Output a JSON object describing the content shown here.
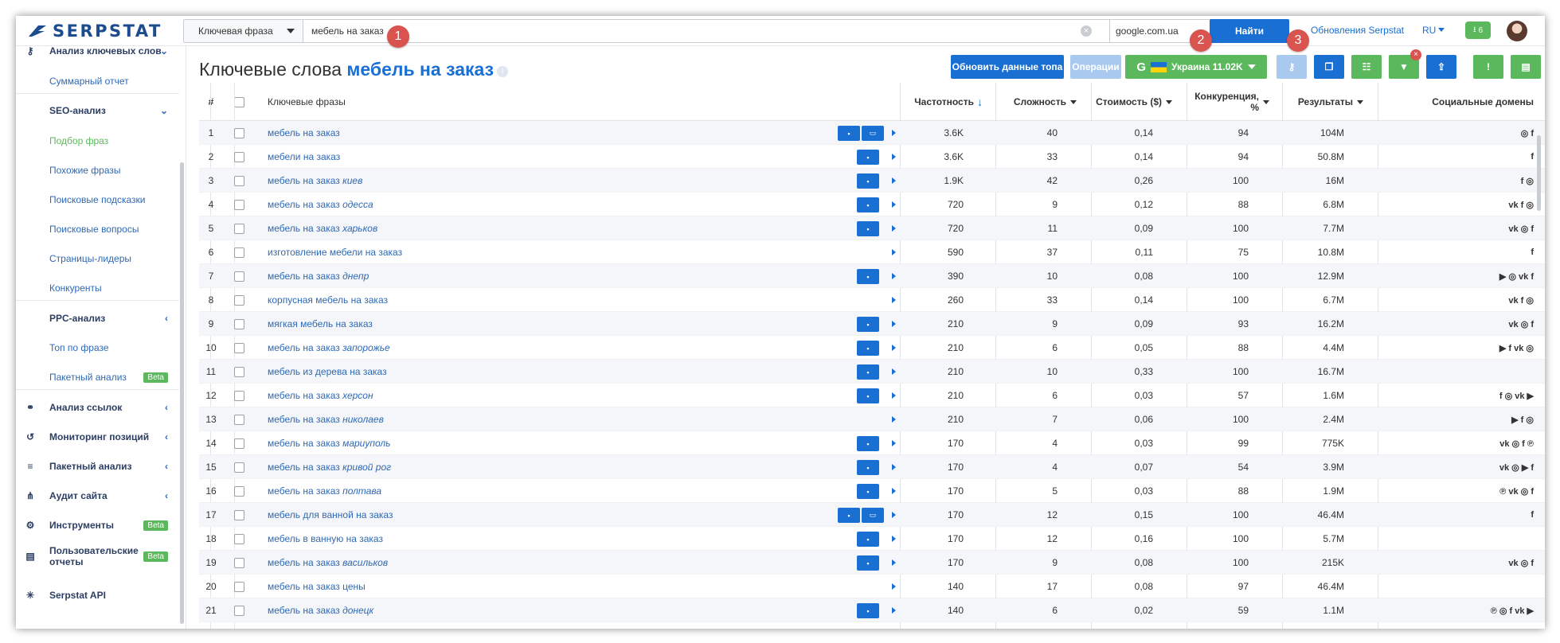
{
  "header": {
    "logo": "SERPSTAT",
    "search_type": "Ключевая фраза",
    "query": "мебель на заказ",
    "search_engine": "google.com.ua",
    "find_label": "Найти",
    "updates_link": "Обновления Serpstat",
    "lang": "RU",
    "downloads_count": "6"
  },
  "sidebar": {
    "items": [
      {
        "label": "Анализ ключевых слов",
        "type": "main",
        "icon": "key-icon",
        "chev": "⌄"
      },
      {
        "label": "Суммарный отчет",
        "type": "sub"
      },
      {
        "label": "SEO-анализ",
        "type": "sub-head",
        "chev": "⌄"
      },
      {
        "label": "Подбор фраз",
        "type": "sub-active"
      },
      {
        "label": "Похожие фразы",
        "type": "sub"
      },
      {
        "label": "Поисковые подсказки",
        "type": "sub"
      },
      {
        "label": "Поисковые вопросы",
        "type": "sub"
      },
      {
        "label": "Страницы-лидеры",
        "type": "sub"
      },
      {
        "label": "Конкуренты",
        "type": "sub"
      },
      {
        "label": "PPC-анализ",
        "type": "sub-head",
        "chev": "‹"
      },
      {
        "label": "Топ по фразе",
        "type": "sub"
      },
      {
        "label": "Пакетный анализ",
        "type": "sub",
        "beta": "Beta"
      },
      {
        "label": "Анализ ссылок",
        "type": "main",
        "icon": "link-icon",
        "chev": "‹"
      },
      {
        "label": "Мониторинг позиций",
        "type": "main",
        "icon": "history-icon",
        "chev": "‹"
      },
      {
        "label": "Пакетный анализ",
        "type": "main",
        "icon": "database-icon",
        "chev": "‹"
      },
      {
        "label": "Аудит сайта",
        "type": "main",
        "icon": "sitemap-icon",
        "chev": "‹"
      },
      {
        "label": "Инструменты",
        "type": "main",
        "icon": "gear-icon",
        "beta": "Beta"
      },
      {
        "label": "Пользовательские отчеты",
        "type": "main",
        "icon": "report-icon",
        "beta": "Beta"
      },
      {
        "label": "Serpstat API",
        "type": "main",
        "icon": "api-icon"
      }
    ]
  },
  "main": {
    "title_prefix": "Ключевые слова",
    "title_keyword": "мебель на заказ",
    "btn_refresh": "Обновить данные топа",
    "btn_operations": "Операции",
    "btn_region": "Украина 11.02K",
    "markers": [
      "1",
      "2",
      "3"
    ]
  },
  "table": {
    "headers": {
      "num": "#",
      "keyword": "Ключевые фразы",
      "freq": "Частотность",
      "difficulty": "Сложность",
      "cost": "Стоимость ($)",
      "competition": "Конкуренция, %",
      "results": "Результаты",
      "social": "Социальные домены"
    },
    "rows": [
      {
        "n": "1",
        "kw": "мебель на заказ",
        "kwi": "",
        "freq": "3.6K",
        "dif": "40",
        "cost": "0,14",
        "comp": "94",
        "res": "104M",
        "serp": 2,
        "soc": "◎ f"
      },
      {
        "n": "2",
        "kw": "мебели на заказ",
        "kwi": "",
        "freq": "3.6K",
        "dif": "33",
        "cost": "0,14",
        "comp": "94",
        "res": "50.8M",
        "serp": 1,
        "soc": "f"
      },
      {
        "n": "3",
        "kw": "мебель на заказ ",
        "kwi": "киев",
        "freq": "1.9K",
        "dif": "42",
        "cost": "0,26",
        "comp": "100",
        "res": "16M",
        "serp": 1,
        "soc": "f ◎"
      },
      {
        "n": "4",
        "kw": "мебель на заказ ",
        "kwi": "одесса",
        "freq": "720",
        "dif": "9",
        "cost": "0,12",
        "comp": "88",
        "res": "6.8M",
        "serp": 1,
        "soc": "vk f ◎"
      },
      {
        "n": "5",
        "kw": "мебель на заказ ",
        "kwi": "харьков",
        "freq": "720",
        "dif": "11",
        "cost": "0,09",
        "comp": "100",
        "res": "7.7M",
        "serp": 1,
        "soc": "vk ◎ f"
      },
      {
        "n": "6",
        "kw": "изготовление мебели на заказ",
        "kwi": "",
        "freq": "590",
        "dif": "37",
        "cost": "0,11",
        "comp": "75",
        "res": "10.8M",
        "serp": 0,
        "soc": "f"
      },
      {
        "n": "7",
        "kw": "мебель на заказ ",
        "kwi": "днепр",
        "freq": "390",
        "dif": "10",
        "cost": "0,08",
        "comp": "100",
        "res": "12.9M",
        "serp": 1,
        "soc": "▶ ◎ vk f"
      },
      {
        "n": "8",
        "kw": "корпусная мебель на заказ",
        "kwi": "",
        "freq": "260",
        "dif": "33",
        "cost": "0,14",
        "comp": "100",
        "res": "6.7M",
        "serp": 0,
        "soc": "vk f ◎"
      },
      {
        "n": "9",
        "kw": "мягкая мебель на заказ",
        "kwi": "",
        "freq": "210",
        "dif": "9",
        "cost": "0,09",
        "comp": "93",
        "res": "16.2M",
        "serp": 1,
        "soc": "vk ◎ f"
      },
      {
        "n": "10",
        "kw": "мебель на заказ ",
        "kwi": "запорожье",
        "freq": "210",
        "dif": "6",
        "cost": "0,05",
        "comp": "88",
        "res": "4.4M",
        "serp": 1,
        "soc": "▶ f vk ◎"
      },
      {
        "n": "11",
        "kw": "мебель из дерева на заказ",
        "kwi": "",
        "freq": "210",
        "dif": "10",
        "cost": "0,33",
        "comp": "100",
        "res": "16.7M",
        "serp": 1,
        "soc": ""
      },
      {
        "n": "12",
        "kw": "мебель на заказ ",
        "kwi": "херсон",
        "freq": "210",
        "dif": "6",
        "cost": "0,03",
        "comp": "57",
        "res": "1.6M",
        "serp": 1,
        "soc": "f ◎ vk ▶"
      },
      {
        "n": "13",
        "kw": "мебель на заказ ",
        "kwi": "николаев",
        "freq": "210",
        "dif": "7",
        "cost": "0,06",
        "comp": "100",
        "res": "2.4M",
        "serp": 0,
        "soc": "▶ f ◎"
      },
      {
        "n": "14",
        "kw": "мебель на заказ ",
        "kwi": "мариуполь",
        "freq": "170",
        "dif": "4",
        "cost": "0,03",
        "comp": "99",
        "res": "775K",
        "serp": 1,
        "soc": "vk ◎ f ℗"
      },
      {
        "n": "15",
        "kw": "мебель на заказ ",
        "kwi": "кривой рог",
        "freq": "170",
        "dif": "4",
        "cost": "0,07",
        "comp": "54",
        "res": "3.9M",
        "serp": 1,
        "soc": "vk ◎ ▶ f"
      },
      {
        "n": "16",
        "kw": "мебель на заказ ",
        "kwi": "полтава",
        "freq": "170",
        "dif": "5",
        "cost": "0,03",
        "comp": "88",
        "res": "1.9M",
        "serp": 1,
        "soc": "℗ vk ◎ f"
      },
      {
        "n": "17",
        "kw": "мебель для ванной на заказ",
        "kwi": "",
        "freq": "170",
        "dif": "12",
        "cost": "0,15",
        "comp": "100",
        "res": "46.4M",
        "serp": 2,
        "soc": "f"
      },
      {
        "n": "18",
        "kw": "мебель в ванную на заказ",
        "kwi": "",
        "freq": "170",
        "dif": "12",
        "cost": "0,16",
        "comp": "100",
        "res": "5.7M",
        "serp": 1,
        "soc": ""
      },
      {
        "n": "19",
        "kw": "мебель на заказ ",
        "kwi": "васильков",
        "freq": "170",
        "dif": "9",
        "cost": "0,08",
        "comp": "100",
        "res": "215K",
        "serp": 1,
        "soc": "vk ◎ f"
      },
      {
        "n": "20",
        "kw": "мебель на заказ цены",
        "kwi": "",
        "freq": "140",
        "dif": "17",
        "cost": "0,08",
        "comp": "97",
        "res": "46.4M",
        "serp": 0,
        "soc": ""
      },
      {
        "n": "21",
        "kw": "мебель на заказ ",
        "kwi": "донецк",
        "freq": "140",
        "dif": "6",
        "cost": "0,02",
        "comp": "59",
        "res": "1.1M",
        "serp": 1,
        "soc": "℗ ◎ f vk ▶"
      }
    ]
  }
}
